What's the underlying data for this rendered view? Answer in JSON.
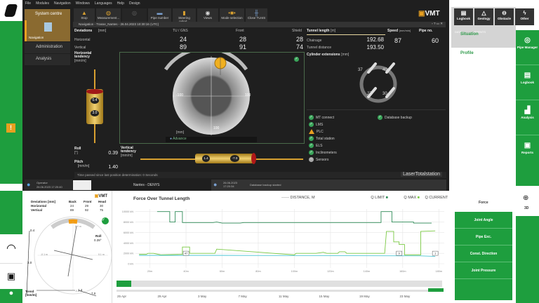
{
  "menu": [
    "File",
    "Modules",
    "Navigation",
    "Windows",
    "Languages",
    "Help",
    "Design"
  ],
  "toolbar": [
    "Stop",
    "Measurement...",
    "",
    "Pipe number",
    "Steering cylind...",
    "Views",
    "Mode selection",
    "Close TUnIS"
  ],
  "brand": "VMT",
  "nav": {
    "system_centre": "System centre",
    "navigation": "Navigation",
    "administration": "Administration",
    "analysis": "Analysis"
  },
  "window_title": "Navigation - Trasse_Nantes - 26.04.2023 10:30:16 (UTC)",
  "deviations": {
    "title": "Deviations",
    "unit": "[mm]",
    "cols": [
      "TU / GNS",
      "Front",
      "Shield"
    ],
    "rows": [
      {
        "label": "Horizontal",
        "values": [
          "24",
          "28",
          "28"
        ]
      },
      {
        "label": "Vertical",
        "values": [
          "89",
          "91",
          "74"
        ]
      }
    ]
  },
  "tunnel": {
    "title": "Tunnel length",
    "unit": "[m]",
    "chainage_label": "Chainage",
    "chainage": "192.68",
    "distance_label": "Tunnel distance",
    "distance": "193.50"
  },
  "speed": {
    "title": "Speed",
    "unit": "[mm/min]",
    "value": "87"
  },
  "pipe": {
    "title": "Pipe no.",
    "value": "60"
  },
  "htend": {
    "title": "Horizontal tendency",
    "unit": "[mm/m]",
    "v1": "0.4",
    "v2": "3.0"
  },
  "target": {
    "left": "-100",
    "right": "100",
    "bottom": "100",
    "unit": "[mm]",
    "mode": "Advance"
  },
  "cylinders": {
    "title": "Cylinder extensions",
    "unit": "[mm]",
    "values": [
      "37",
      "40",
      "27",
      "30"
    ]
  },
  "status": [
    {
      "label": "MT connect",
      "state": "ok"
    },
    {
      "label": "LMS",
      "state": "ok"
    },
    {
      "label": "PLC",
      "state": "warn"
    },
    {
      "label": "Total station",
      "state": "ok"
    },
    {
      "label": "ELS",
      "state": "ok"
    },
    {
      "label": "Inclinometers",
      "state": "ok"
    },
    {
      "label": "Sensors",
      "state": "off"
    }
  ],
  "status_right": {
    "label": "Database backup",
    "state": "ok"
  },
  "roll": {
    "label": "Roll",
    "unit": "[°]",
    "value": "0.39"
  },
  "pitch": {
    "label": "Pitch",
    "unit": "[mm/m]",
    "value": "1.40"
  },
  "vtend": {
    "title": "Vertical tendency",
    "unit": "[mm/m]",
    "v1": "1.4",
    "v2": "-7.0"
  },
  "time_passed": "Time passed since last position determination: 0 Seconds",
  "laser": "LaserTotalstation",
  "statusbar": {
    "operator": "Operator",
    "op_time": "26.06.2023 17:20:40",
    "project": "Nantes - DENYS",
    "msg_time": "26.06.2023 17:20:34",
    "message": "Database backup started"
  },
  "right": {
    "buttons": [
      "Logbook",
      "Geology",
      "Obstacle",
      "Other"
    ],
    "tabs": [
      "DATA",
      "EVENTS"
    ],
    "situation": "Situation",
    "profile": "Profile",
    "side": [
      "Pipe Manager",
      "Logbook",
      "Analysis",
      "Reports"
    ],
    "threed": "3D",
    "force": "Force",
    "force_buttons": [
      "Joint Angle",
      "Pipe Exc.",
      "Const. Direction",
      "Joint Pressure"
    ]
  },
  "mini": {
    "title": "Deviations [mm]",
    "cols": [
      "Back",
      "Front",
      "Head"
    ],
    "rows": [
      {
        "label": "Horizontal",
        "values": [
          "24",
          "29",
          "30"
        ]
      },
      {
        "label": "Vertical",
        "values": [
          "89",
          "92",
          "75"
        ]
      }
    ],
    "roll_label": "Roll",
    "roll": "0.39°",
    "a": "0.4",
    "b": "3.0",
    "c": "1.4",
    "d": "7.0",
    "trend": "Trend [mm/m]",
    "t_top": "0.2 m",
    "t_bot": "-0.2 m",
    "t_left": "-0.1 m",
    "t_right": "0.1 m"
  },
  "colors": {
    "green": "#1e9e3e",
    "qlimit": "#2e8b57",
    "qmax": "#7ac943",
    "qcurrent": "#4fc6d6",
    "orange": "#e8a020"
  },
  "chart_data": {
    "type": "line",
    "title": "Force Over Tunnel Length",
    "legend": [
      "DISTANCE, M",
      "Q LIMIT",
      "Q MAX",
      "Q CURRENT"
    ],
    "xlabel": "",
    "ylabel": "",
    "xlim": [
      12,
      183
    ],
    "ylim": [
      0,
      10500
    ],
    "xticks": [
      20,
      40,
      60,
      80,
      100,
      120,
      140,
      160,
      180
    ],
    "xtick_labels": [
      "20m",
      "40m",
      "60m",
      "80m",
      "100m",
      "120m",
      "140m",
      "160m",
      "180m"
    ],
    "yticks": [
      0,
      2000,
      4000,
      6000,
      8000,
      10000
    ],
    "ytick_labels": [
      "0 kN",
      "2000 kN",
      "4000 kN",
      "6000 kN",
      "8000 kN",
      "10000 kN"
    ],
    "series": [
      {
        "name": "Q LIMIT",
        "points": [
          [
            24,
            10000
          ],
          [
            31,
            10000
          ],
          [
            31,
            8000
          ],
          [
            34,
            8000
          ],
          [
            34,
            10000
          ],
          [
            38,
            10000
          ],
          [
            38,
            7900
          ],
          [
            55,
            7900
          ],
          [
            57,
            8000
          ],
          [
            60,
            7800
          ],
          [
            70,
            7800
          ],
          [
            72,
            7900
          ],
          [
            148,
            7900
          ],
          [
            148,
            10000
          ],
          [
            154,
            10000
          ],
          [
            154,
            8000
          ],
          [
            166,
            8000
          ],
          [
            166,
            7800
          ],
          [
            176,
            7800
          ]
        ]
      },
      {
        "name": "Q MAX",
        "points": [
          [
            14,
            1800
          ],
          [
            18,
            1800
          ],
          [
            19,
            2000
          ],
          [
            22,
            2000
          ],
          [
            26,
            1700
          ],
          [
            38,
            1800
          ],
          [
            38,
            3200
          ],
          [
            42,
            3200
          ],
          [
            42,
            2000
          ],
          [
            56,
            2000
          ],
          [
            57,
            2800
          ],
          [
            100,
            1700
          ],
          [
            101,
            2000
          ],
          [
            112,
            2000
          ],
          [
            116,
            2200
          ],
          [
            118,
            2000
          ],
          [
            124,
            2000
          ],
          [
            125,
            2300
          ],
          [
            128,
            2300
          ],
          [
            129,
            2000
          ],
          [
            150,
            2000
          ],
          [
            151,
            6200
          ],
          [
            155,
            6200
          ],
          [
            155,
            4200
          ],
          [
            158,
            4200
          ],
          [
            158,
            3700
          ],
          [
            161,
            3700
          ],
          [
            161,
            1700
          ],
          [
            170,
            1700
          ],
          [
            170,
            6200
          ],
          [
            178,
            6300
          ]
        ]
      },
      {
        "name": "Q CURRENT",
        "points": [
          [
            14,
            1600
          ],
          [
            60,
            1600
          ],
          [
            120,
            1550
          ],
          [
            170,
            1500
          ],
          [
            178,
            1400
          ]
        ]
      }
    ],
    "markers": [
      {
        "x": 40,
        "label": "47"
      },
      {
        "x": 158,
        "label": "9"
      },
      {
        "x": 178,
        "label": "1"
      }
    ],
    "date_ticks": [
      "25 Apr",
      "29 Apr",
      "3 May",
      "7 May",
      "11 May",
      "15 May",
      "19 May",
      "23 May"
    ],
    "grid": true,
    "legend_position": "top"
  }
}
